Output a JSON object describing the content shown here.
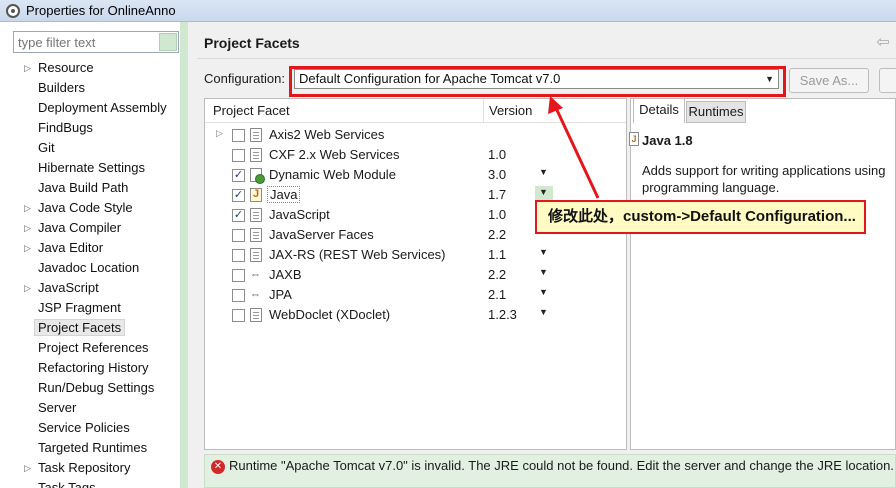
{
  "window": {
    "title": "Properties for OnlineAnno"
  },
  "filter": {
    "placeholder": "type filter text"
  },
  "sidebar": {
    "items": [
      {
        "label": "Resource",
        "expandable": true
      },
      {
        "label": "Builders",
        "expandable": false
      },
      {
        "label": "Deployment Assembly",
        "expandable": false
      },
      {
        "label": "FindBugs",
        "expandable": false
      },
      {
        "label": "Git",
        "expandable": false
      },
      {
        "label": "Hibernate Settings",
        "expandable": false
      },
      {
        "label": "Java Build Path",
        "expandable": false
      },
      {
        "label": "Java Code Style",
        "expandable": true
      },
      {
        "label": "Java Compiler",
        "expandable": true
      },
      {
        "label": "Java Editor",
        "expandable": true
      },
      {
        "label": "Javadoc Location",
        "expandable": false
      },
      {
        "label": "JavaScript",
        "expandable": true
      },
      {
        "label": "JSP Fragment",
        "expandable": false
      },
      {
        "label": "Project Facets",
        "expandable": false,
        "selected": true
      },
      {
        "label": "Project References",
        "expandable": false
      },
      {
        "label": "Refactoring History",
        "expandable": false
      },
      {
        "label": "Run/Debug Settings",
        "expandable": false
      },
      {
        "label": "Server",
        "expandable": false
      },
      {
        "label": "Service Policies",
        "expandable": false
      },
      {
        "label": "Targeted Runtimes",
        "expandable": false
      },
      {
        "label": "Task Repository",
        "expandable": true
      },
      {
        "label": "Task Tags",
        "expandable": false
      }
    ]
  },
  "page": {
    "title": "Project Facets",
    "configuration_label": "Configuration:",
    "configuration_value": "Default Configuration for Apache Tomcat v7.0",
    "save_as_label": "Save As..."
  },
  "facets": {
    "header_facet": "Project Facet",
    "header_version": "Version",
    "rows": [
      {
        "name": "Axis2 Web Services",
        "version": "",
        "checked": false,
        "expandable": true,
        "icon": "doc-icon",
        "dropdown": false
      },
      {
        "name": "CXF 2.x Web Services",
        "version": "1.0",
        "checked": false,
        "expandable": false,
        "icon": "doc-icon",
        "dropdown": false
      },
      {
        "name": "Dynamic Web Module",
        "version": "3.0",
        "checked": true,
        "expandable": false,
        "icon": "web-module-icon",
        "dropdown": true
      },
      {
        "name": "Java",
        "version": "1.7",
        "checked": true,
        "expandable": false,
        "icon": "java-icon",
        "dropdown": true
      },
      {
        "name": "JavaScript",
        "version": "1.0",
        "checked": true,
        "expandable": false,
        "icon": "doc-icon",
        "dropdown": false
      },
      {
        "name": "JavaServer Faces",
        "version": "2.2",
        "checked": false,
        "expandable": false,
        "icon": "doc-icon",
        "dropdown": false
      },
      {
        "name": "JAX-RS (REST Web Services)",
        "version": "1.1",
        "checked": false,
        "expandable": false,
        "icon": "doc-icon",
        "dropdown": true
      },
      {
        "name": "JAXB",
        "version": "2.2",
        "checked": false,
        "expandable": false,
        "icon": "arrows-icon",
        "dropdown": true
      },
      {
        "name": "JPA",
        "version": "2.1",
        "checked": false,
        "expandable": false,
        "icon": "arrows-icon",
        "dropdown": true
      },
      {
        "name": "WebDoclet (XDoclet)",
        "version": "1.2.3",
        "checked": false,
        "expandable": false,
        "icon": "doc-icon",
        "dropdown": true
      }
    ]
  },
  "details": {
    "tab_details": "Details",
    "tab_runtimes": "Runtimes",
    "java_title": "Java 1.8",
    "description_line1": "Adds support for writing applications using",
    "description_line2": "programming language."
  },
  "error": {
    "message": "Runtime \"Apache Tomcat v7.0\" is invalid. The JRE could not be found. Edit the server and change the JRE location."
  },
  "annotation": {
    "text": "修改此处，custom->Default Configuration..."
  },
  "colors": {
    "highlight_red": "#e3161c",
    "callout_bg": "#fffbc2",
    "error_bar_bg": "#e2f0e2"
  }
}
